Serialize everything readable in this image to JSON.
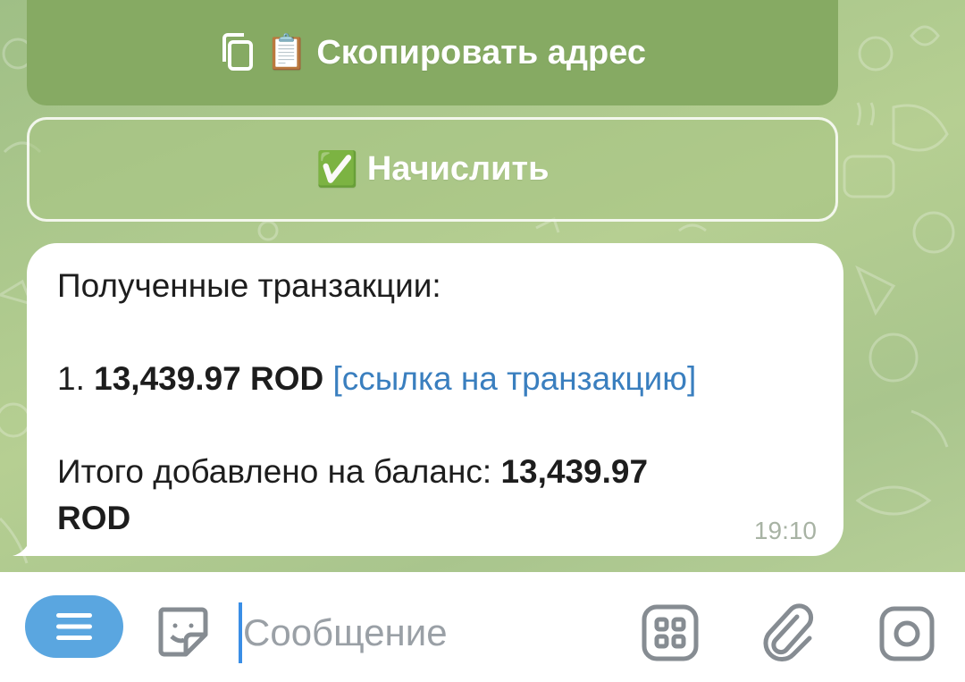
{
  "keyboard": {
    "copy_button": {
      "icon": "copy-icon",
      "emoji": "📋",
      "label": "Скопировать адрес"
    },
    "credit_button": {
      "emoji": "✅",
      "label": "Начислить"
    }
  },
  "message": {
    "header": "Полученные транзакции:",
    "item_number": "1.",
    "item_amount": "13,439.97 ROD",
    "item_link": "[ссылка на транзакцию]",
    "total_label": "Итого добавлено на баланс:",
    "total_amount_line1": "13,439.97",
    "total_amount_line2": "ROD",
    "time": "19:10"
  },
  "input_bar": {
    "menu_icon": "menu-icon",
    "sticker_icon": "sticker-icon",
    "placeholder": "Сообщение",
    "commands_icon": "bot-commands-icon",
    "attach_icon": "paperclip-icon",
    "camera_icon": "camera-icon"
  },
  "colors": {
    "accent": "#5aa6e0",
    "link": "#3a7fbf",
    "button_green": "#86aa63"
  }
}
